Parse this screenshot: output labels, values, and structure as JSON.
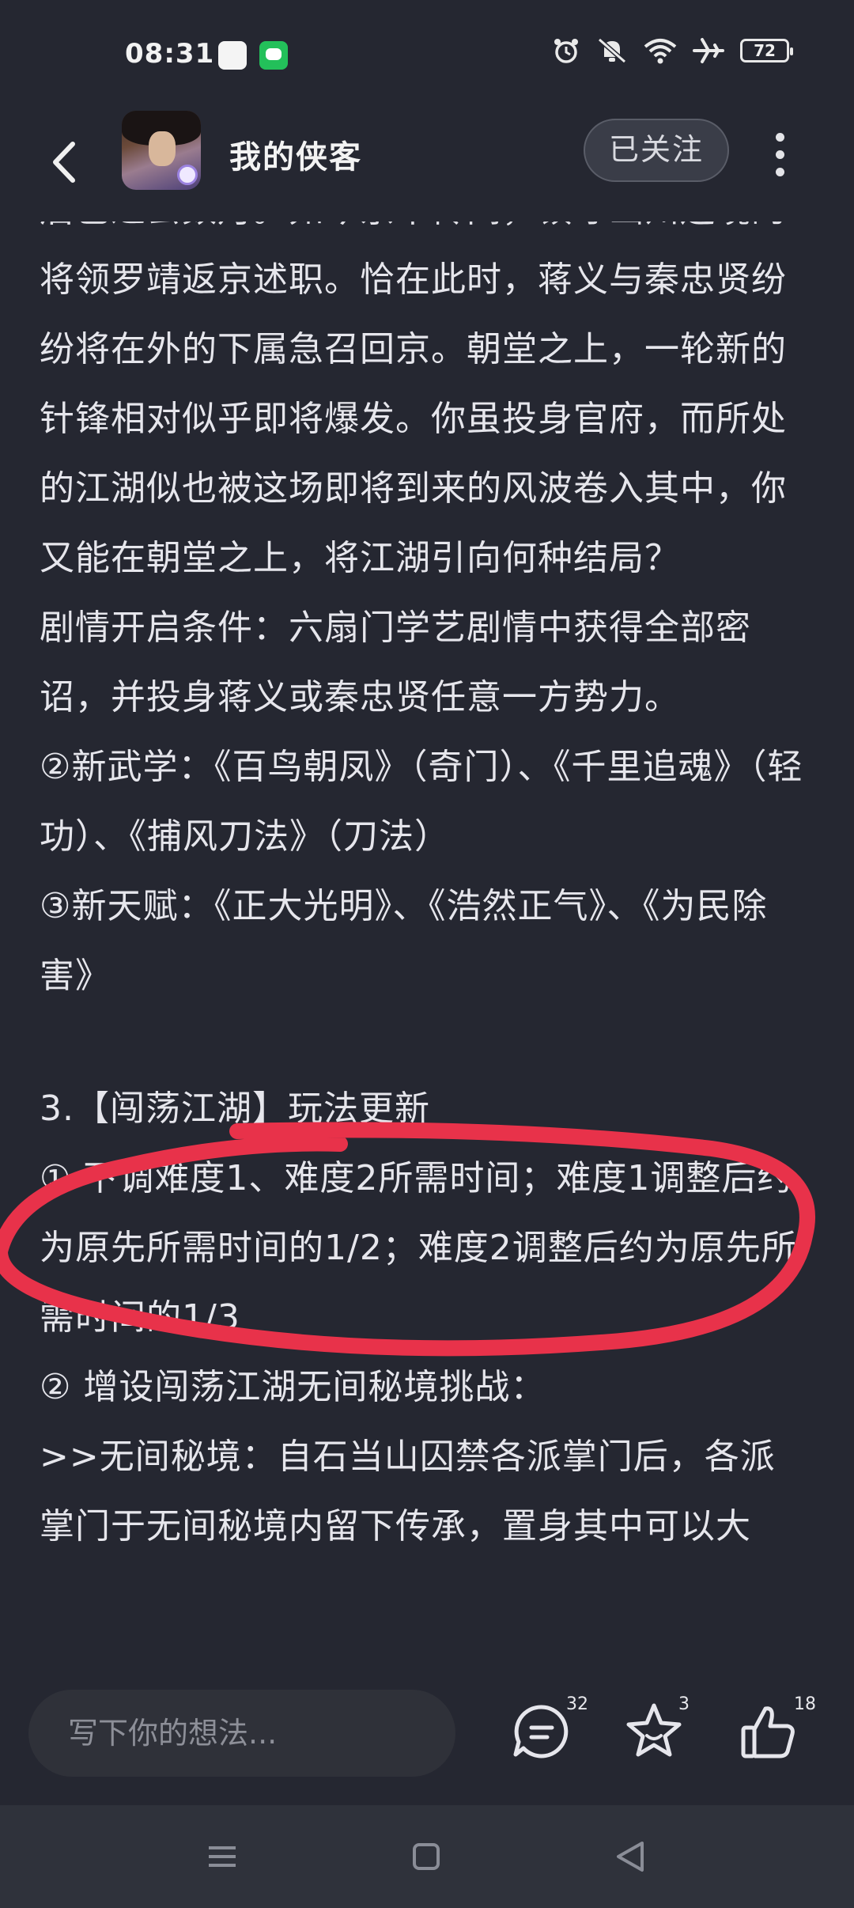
{
  "status_bar": {
    "time": "08:31",
    "battery": "72"
  },
  "header": {
    "title": "我的侠客",
    "follow_label": "已关注"
  },
  "article": {
    "paragraphs": [
      "后已过去数月。如今京中传闻，镇守幽州边境的将领罗靖返京述职。恰在此时，蒋义与秦忠贤纷纷将在外的下属急召回京。朝堂之上，一轮新的针锋相对似乎即将爆发。你虽投身官府，而所处的江湖似也被这场即将到来的风波卷入其中，你又能在朝堂之上，将江湖引向何种结局？",
      "剧情开启条件：六扇门学艺剧情中获得全部密诏，并投身蒋义或秦忠贤任意一方势力。",
      "②新武学：《百鸟朝凤》（奇门）、《千里追魂》（轻功）、《捕风刀法》（刀法）",
      "③新天赋：《正大光明》、《浩然正气》、《为民除害》",
      "3.【闯荡江湖】玩法更新",
      "① 下调难度1、难度2所需时间；难度1调整后约为原先所需时间的1/2；难度2调整后约为原先所需时间的1/3",
      "② 增设闯荡江湖无间秘境挑战：",
      ">>无间秘境：自石当山囚禁各派掌门后，各派掌门于无间秘境内留下传承，置身其中可以大"
    ]
  },
  "bottom_bar": {
    "comment_placeholder": "写下你的想法...",
    "comment_count": "32",
    "favorite_count": "3",
    "like_count": "18"
  },
  "colors": {
    "background": "#252731",
    "annotation_red": "#e8324a",
    "text": "#e6e6ec"
  },
  "icons": [
    "back-arrow-icon",
    "more-vertical-icon",
    "comment-icon",
    "star-icon",
    "thumbs-up-icon",
    "menu-icon",
    "home-square-icon",
    "back-triangle-icon",
    "alarm-icon",
    "mute-icon",
    "wifi-icon",
    "airplane-icon",
    "battery-icon"
  ]
}
